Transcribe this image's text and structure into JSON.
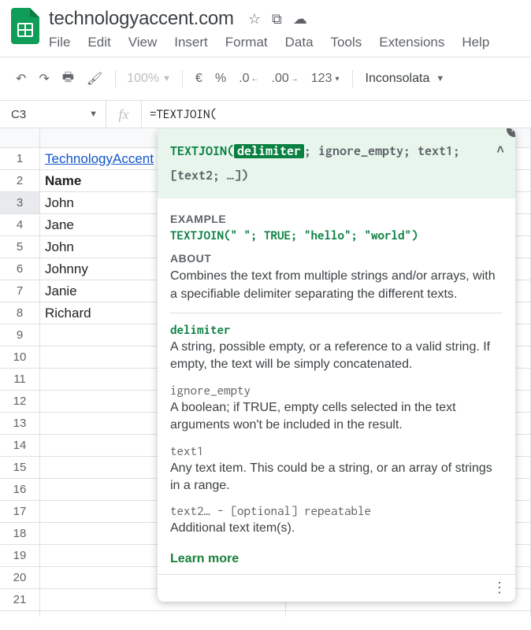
{
  "header": {
    "doc_title": "technologyaccent.com",
    "icons": {
      "star": "☆",
      "move": "⧉",
      "cloud": "☁"
    }
  },
  "menu": {
    "file": "File",
    "edit": "Edit",
    "view": "View",
    "insert": "Insert",
    "format": "Format",
    "data": "Data",
    "tools": "Tools",
    "extensions": "Extensions",
    "help": "Help"
  },
  "toolbar": {
    "zoom": "100%",
    "currency": "€",
    "percent": "%",
    "dec_dec": ".0",
    "dec_inc": ".00",
    "num_fmt": "123",
    "font": "Inconsolata"
  },
  "fxrow": {
    "cell_ref": "C3",
    "fx_label": "fx",
    "formula": "=TEXTJOIN("
  },
  "rows": {
    "r1": {
      "a": "TechnologyAccent"
    },
    "r2": {
      "a": "Name"
    },
    "r3": {
      "a": "John"
    },
    "r4": {
      "a": "Jane"
    },
    "r5": {
      "a": "John"
    },
    "r6": {
      "a": "Johnny"
    },
    "r7": {
      "a": "Janie"
    },
    "r8": {
      "a": "Richard"
    }
  },
  "tip": {
    "sig_fn": "TEXTJOIN(",
    "sig_hl": "delimiter",
    "sig_rest": "; ignore_empty; text1; [text2; …])",
    "example_label": "EXAMPLE",
    "example": "TEXTJOIN(\" \"; TRUE; \"hello\"; \"world\")",
    "about_label": "ABOUT",
    "about": "Combines the text from multiple strings and/or arrays, with a specifiable delimiter separating the different texts.",
    "p1_name": "delimiter",
    "p1_desc": "A string, possible empty, or a reference to a valid string. If empty, the text will be simply concatenated.",
    "p2_name": "ignore_empty",
    "p2_desc": "A boolean; if TRUE, empty cells selected in the text arguments won't be included in the result.",
    "p3_name": "text1",
    "p3_desc": "Any text item. This could be a string, or an array of strings in a range.",
    "p4_name": "text2… - [optional] repeatable",
    "p4_desc": "Additional text item(s).",
    "learn": "Learn more"
  }
}
